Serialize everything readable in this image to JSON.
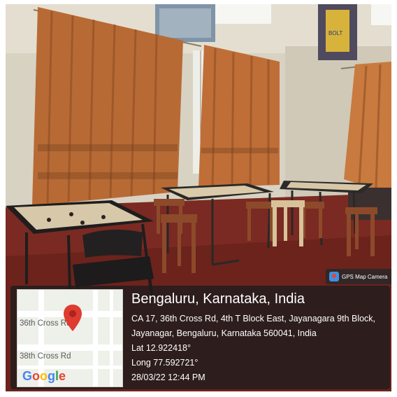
{
  "gps_badge": {
    "text": "GPS Map Camera",
    "icon": "gps-map-camera-icon"
  },
  "map": {
    "street_top": "36th Cross Rd",
    "street_bottom": "38th Cross Rd",
    "logo": [
      "G",
      "o",
      "o",
      "g",
      "l",
      "e"
    ],
    "pin_icon": "map-pin-icon",
    "pin_color": "#e03b2f"
  },
  "location": {
    "place": "Bengaluru, Karnataka, India",
    "address": "CA 17, 36th Cross Rd, 4th T Block East, Jayanagara 9th Block, Jayanagar, Bengaluru, Karnataka 560041, India",
    "lat": "Lat 12.922418°",
    "long": "Long 77.592721°",
    "datetime": "28/03/22 12:44 PM"
  },
  "photo": {
    "subject": "room with carrom boards, tables, stools and orange patterned curtains",
    "poster_right_text": "BOLT"
  }
}
